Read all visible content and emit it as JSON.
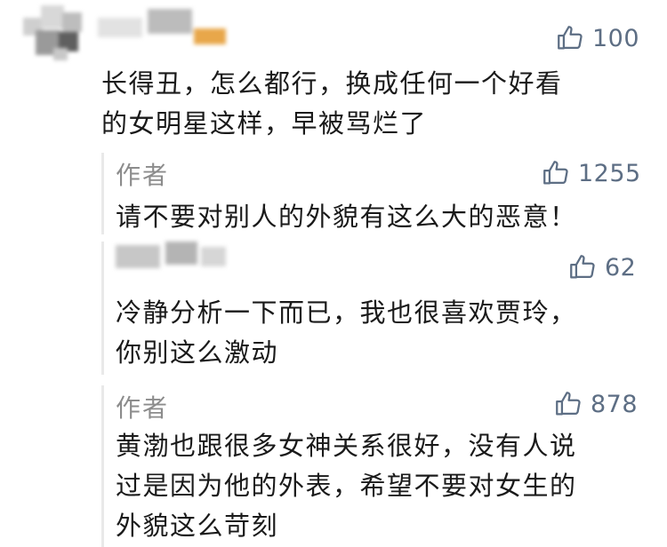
{
  "comment": {
    "likes": "100",
    "lines": [
      "长得丑，怎么都行，换成任何一个好看",
      "的女明星这样，早被骂烂了"
    ]
  },
  "replies": [
    {
      "author": "作者",
      "likes": "1255",
      "lines": [
        "请不要对别人的外貌有这么大的恶意！"
      ]
    },
    {
      "author": "",
      "likes": "62",
      "lines": [
        "冷静分析一下而已，我也很喜欢贾玲，",
        "你别这么激动"
      ]
    },
    {
      "author": "作者",
      "likes": "878",
      "lines": [
        "黄渤也跟很多女神关系很好，没有人说",
        "过是因为他的外表，希望不要对女生的",
        "外貌这么苛刻"
      ]
    }
  ],
  "icons": {
    "like": "thumbs-up-icon",
    "avatar": "blurred-avatar-icon"
  },
  "colors": {
    "like": "#5d6e84",
    "author": "#8c8c8c",
    "text": "#1a1a1a"
  }
}
